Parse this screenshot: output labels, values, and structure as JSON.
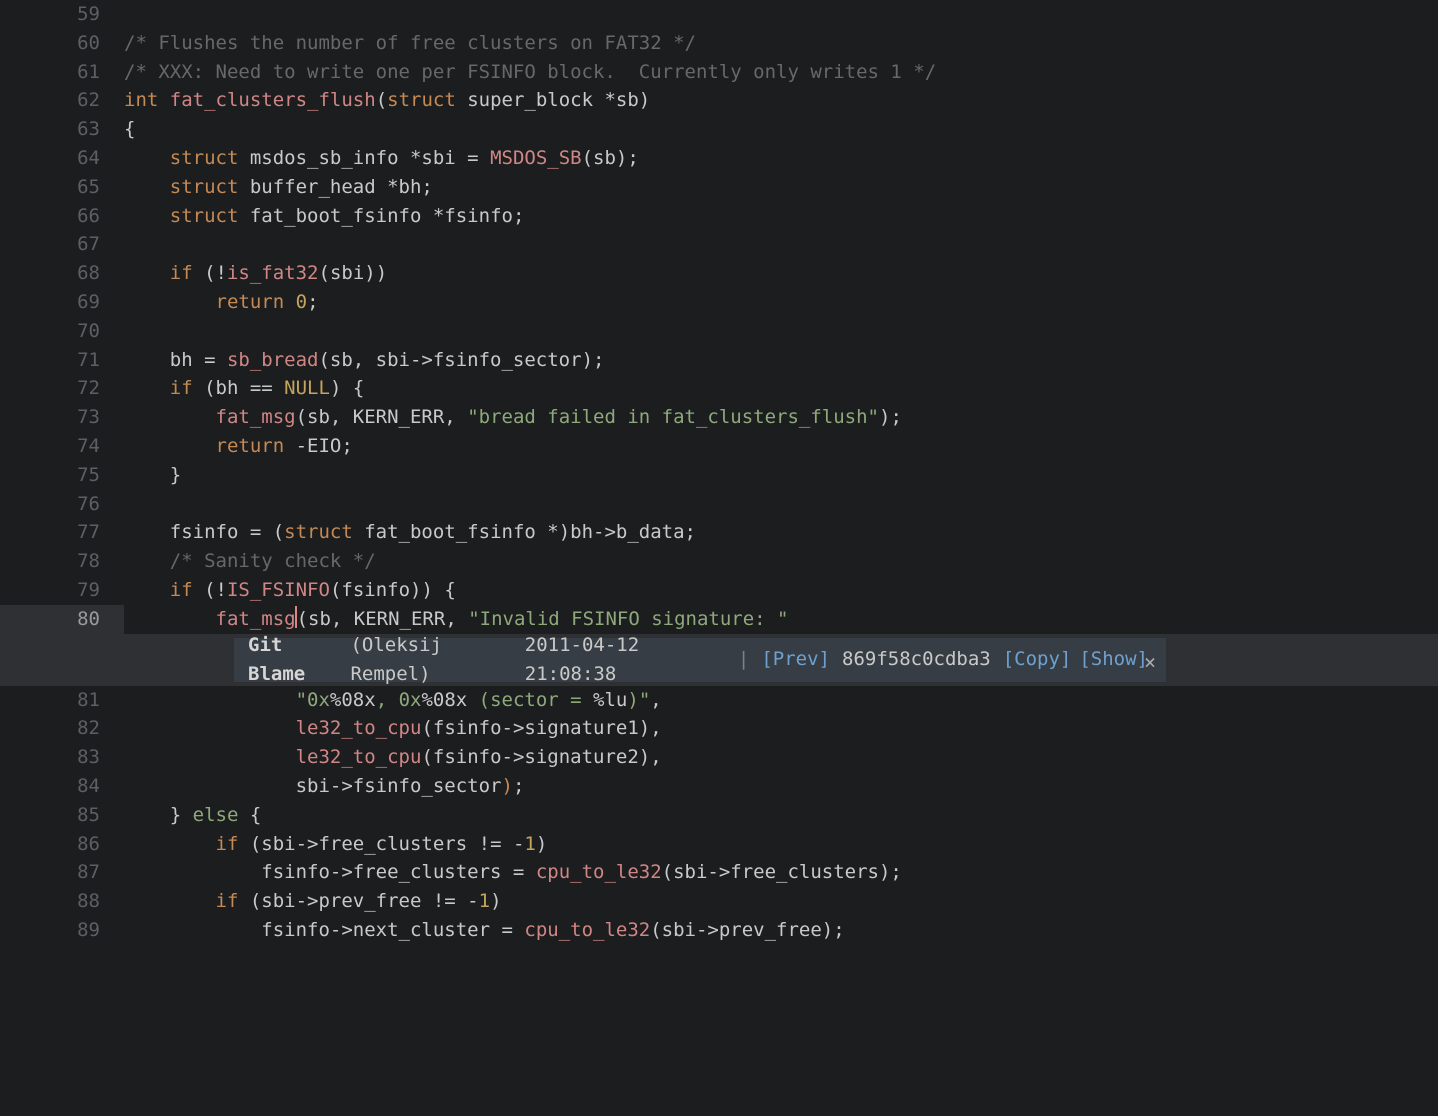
{
  "editor": {
    "first_line": 59,
    "current_line": 80,
    "lines": [
      {
        "n": 59,
        "tokens": []
      },
      {
        "n": 60,
        "tokens": [
          {
            "t": "/* Flushes the number of free clusters on FAT32 */",
            "c": "c-comment"
          }
        ]
      },
      {
        "n": 61,
        "tokens": [
          {
            "t": "/* XXX: Need to write one per FSINFO block.  Currently only writes 1 */",
            "c": "c-comment"
          }
        ]
      },
      {
        "n": 62,
        "tokens": [
          {
            "t": "int",
            "c": "c-type"
          },
          {
            "t": " "
          },
          {
            "t": "fat_clusters_flush",
            "c": "c-func"
          },
          {
            "t": "("
          },
          {
            "t": "struct",
            "c": "c-type"
          },
          {
            "t": " super_block *sb)"
          }
        ]
      },
      {
        "n": 63,
        "tokens": [
          {
            "t": "{"
          }
        ]
      },
      {
        "n": 64,
        "tokens": [
          {
            "t": "    "
          },
          {
            "t": "struct",
            "c": "c-type"
          },
          {
            "t": " msdos_sb_info *sbi = "
          },
          {
            "t": "MSDOS_SB",
            "c": "c-macro"
          },
          {
            "t": "(sb);"
          }
        ]
      },
      {
        "n": 65,
        "tokens": [
          {
            "t": "    "
          },
          {
            "t": "struct",
            "c": "c-type"
          },
          {
            "t": " buffer_head *bh;"
          }
        ]
      },
      {
        "n": 66,
        "tokens": [
          {
            "t": "    "
          },
          {
            "t": "struct",
            "c": "c-type"
          },
          {
            "t": " fat_boot_fsinfo *fsinfo;"
          }
        ]
      },
      {
        "n": 67,
        "tokens": []
      },
      {
        "n": 68,
        "tokens": [
          {
            "t": "    "
          },
          {
            "t": "if",
            "c": "c-keyword"
          },
          {
            "t": " (!"
          },
          {
            "t": "is_fat32",
            "c": "c-call"
          },
          {
            "t": "(sbi))"
          }
        ]
      },
      {
        "n": 69,
        "tokens": [
          {
            "t": "        "
          },
          {
            "t": "return",
            "c": "c-keyword"
          },
          {
            "t": " "
          },
          {
            "t": "0",
            "c": "c-num"
          },
          {
            "t": ";"
          }
        ]
      },
      {
        "n": 70,
        "tokens": []
      },
      {
        "n": 71,
        "tokens": [
          {
            "t": "    bh = "
          },
          {
            "t": "sb_bread",
            "c": "c-call"
          },
          {
            "t": "(sb, sbi->fsinfo_sector);"
          }
        ]
      },
      {
        "n": 72,
        "tokens": [
          {
            "t": "    "
          },
          {
            "t": "if",
            "c": "c-keyword"
          },
          {
            "t": " (bh == "
          },
          {
            "t": "NULL",
            "c": "c-num"
          },
          {
            "t": ") {"
          }
        ]
      },
      {
        "n": 73,
        "tokens": [
          {
            "t": "        "
          },
          {
            "t": "fat_msg",
            "c": "c-call"
          },
          {
            "t": "(sb, KERN_ERR, "
          },
          {
            "t": "\"bread failed in fat_clusters_flush\"",
            "c": "c-string"
          },
          {
            "t": ");"
          }
        ]
      },
      {
        "n": 74,
        "tokens": [
          {
            "t": "        "
          },
          {
            "t": "return",
            "c": "c-keyword"
          },
          {
            "t": " -EIO;"
          }
        ]
      },
      {
        "n": 75,
        "tokens": [
          {
            "t": "    }"
          }
        ]
      },
      {
        "n": 76,
        "tokens": []
      },
      {
        "n": 77,
        "tokens": [
          {
            "t": "    fsinfo = ("
          },
          {
            "t": "struct",
            "c": "c-type"
          },
          {
            "t": " fat_boot_fsinfo *)bh->b_data;"
          }
        ]
      },
      {
        "n": 78,
        "tokens": [
          {
            "t": "    "
          },
          {
            "t": "/* Sanity check */",
            "c": "c-comment"
          }
        ]
      },
      {
        "n": 79,
        "tokens": [
          {
            "t": "    "
          },
          {
            "t": "if",
            "c": "c-keyword"
          },
          {
            "t": " (!"
          },
          {
            "t": "IS_FSINFO",
            "c": "c-macro"
          },
          {
            "t": "(fsinfo)) {"
          }
        ]
      },
      {
        "n": 80,
        "tokens": [
          {
            "t": "        "
          },
          {
            "t": "fat_msg",
            "c": "c-call"
          },
          {
            "caret": true
          },
          {
            "t": "("
          },
          {
            "t": "sb, KERN_ERR, "
          },
          {
            "t": "\"Invalid FSINFO signature: \"",
            "c": "c-string"
          }
        ]
      },
      {
        "n": 81,
        "tokens": [
          {
            "t": "               "
          },
          {
            "t": "\"0x",
            "c": "c-string"
          },
          {
            "t": "%08x"
          },
          {
            "t": ", 0x",
            "c": "c-string"
          },
          {
            "t": "%08x "
          },
          {
            "t": "(sector = ",
            "c": "c-string"
          },
          {
            "t": "%lu"
          },
          {
            "t": ")\"",
            "c": "c-string"
          },
          {
            "t": ","
          }
        ]
      },
      {
        "n": 82,
        "tokens": [
          {
            "t": "               "
          },
          {
            "t": "le32_to_cpu",
            "c": "c-call"
          },
          {
            "t": "(fsinfo->signature1),"
          }
        ]
      },
      {
        "n": 83,
        "tokens": [
          {
            "t": "               "
          },
          {
            "t": "le32_to_cpu",
            "c": "c-call"
          },
          {
            "t": "(fsinfo->signature2),"
          }
        ]
      },
      {
        "n": 84,
        "tokens": [
          {
            "t": "               sbi->fsinfo_sector"
          },
          {
            "t": ")",
            "c": "c-punct"
          },
          {
            "t": ";"
          }
        ]
      },
      {
        "n": 85,
        "tokens": [
          {
            "t": "    } "
          },
          {
            "t": "else",
            "c": "c-else"
          },
          {
            "t": " {"
          }
        ]
      },
      {
        "n": 86,
        "tokens": [
          {
            "t": "        "
          },
          {
            "t": "if",
            "c": "c-keyword"
          },
          {
            "t": " (sbi->free_clusters != -"
          },
          {
            "t": "1",
            "c": "c-num"
          },
          {
            "t": ")"
          }
        ]
      },
      {
        "n": 87,
        "tokens": [
          {
            "t": "            fsinfo->free_clusters = "
          },
          {
            "t": "cpu_to_le32",
            "c": "c-call"
          },
          {
            "t": "(sbi->free_clusters);"
          }
        ]
      },
      {
        "n": 88,
        "tokens": [
          {
            "t": "        "
          },
          {
            "t": "if",
            "c": "c-keyword"
          },
          {
            "t": " (sbi->prev_free != -"
          },
          {
            "t": "1",
            "c": "c-num"
          },
          {
            "t": ")"
          }
        ]
      },
      {
        "n": 89,
        "tokens": [
          {
            "t": "            fsinfo->next_cluster = "
          },
          {
            "t": "cpu_to_le32",
            "c": "c-call"
          },
          {
            "t": "(sbi->prev_free);"
          }
        ]
      }
    ]
  },
  "blame": {
    "label": "Git Blame",
    "author": "(Oleksij Rempel)",
    "date": "2011-04-12 21:08:38",
    "sep": "|",
    "prev": "[Prev]",
    "hash": "869f58c0cdba3",
    "copy": "[Copy]",
    "show": "[Show]",
    "close": "×"
  }
}
